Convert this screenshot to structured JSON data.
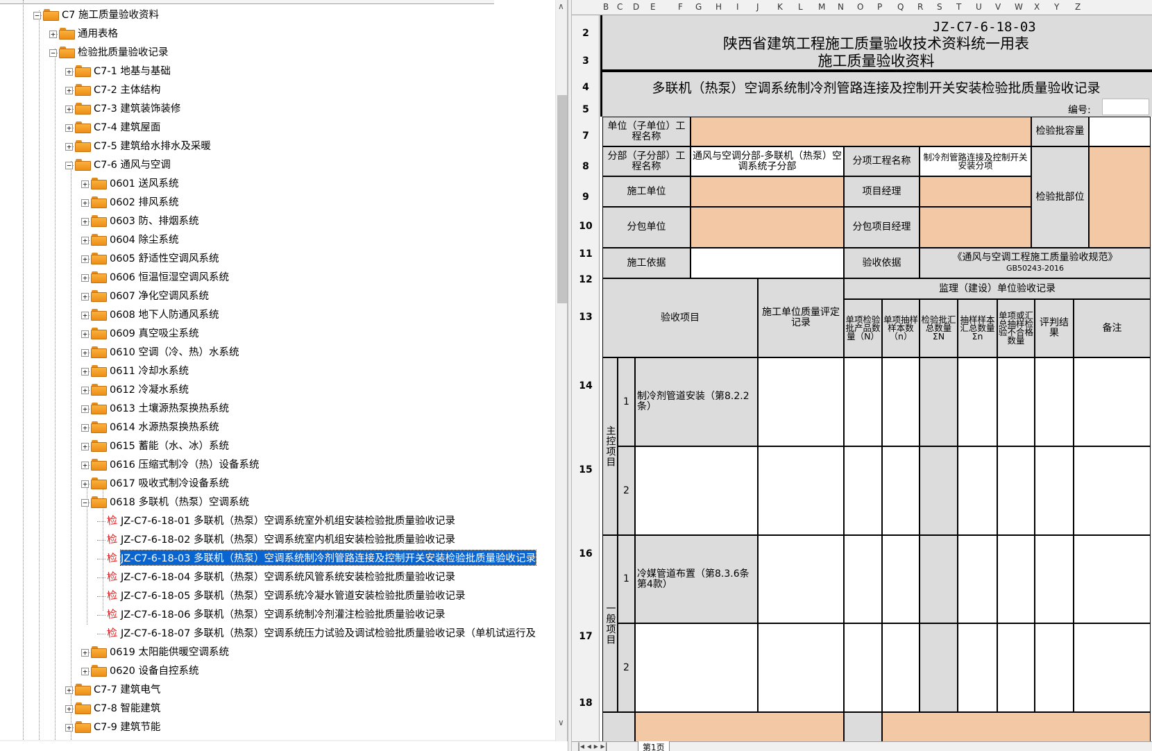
{
  "tree": {
    "items": [
      {
        "label": "C7 施工质量验收资料",
        "icon": "folder-open-icon",
        "expander": "−"
      },
      {
        "label": "通用表格",
        "icon": "folder-icon",
        "expander": "+"
      },
      {
        "label": "检验批质量验收记录",
        "icon": "folder-open-icon",
        "expander": "−"
      },
      {
        "label": "C7-1 地基与基础",
        "icon": "folder-icon",
        "expander": "+"
      },
      {
        "label": "C7-2 主体结构",
        "icon": "folder-icon",
        "expander": "+"
      },
      {
        "label": "C7-3 建筑装饰装修",
        "icon": "folder-icon",
        "expander": "+"
      },
      {
        "label": "C7-4 建筑屋面",
        "icon": "folder-icon",
        "expander": "+"
      },
      {
        "label": "C7-5 建筑给水排水及采暖",
        "icon": "folder-icon",
        "expander": "+"
      },
      {
        "label": "C7-6 通风与空调",
        "icon": "folder-open-icon",
        "expander": "−"
      },
      {
        "label": "0601 送风系统",
        "icon": "folder-icon",
        "expander": "+"
      },
      {
        "label": "0602 排风系统",
        "icon": "folder-icon",
        "expander": "+"
      },
      {
        "label": "0603 防、排烟系统",
        "icon": "folder-icon",
        "expander": "+"
      },
      {
        "label": "0604 除尘系统",
        "icon": "folder-icon",
        "expander": "+"
      },
      {
        "label": "0605 舒适性空调风系统",
        "icon": "folder-icon",
        "expander": "+"
      },
      {
        "label": "0606 恒温恒湿空调风系统",
        "icon": "folder-icon",
        "expander": "+"
      },
      {
        "label": "0607 净化空调风系统",
        "icon": "folder-icon",
        "expander": "+"
      },
      {
        "label": "0608 地下人防通风系统",
        "icon": "folder-icon",
        "expander": "+"
      },
      {
        "label": "0609 真空吸尘系统",
        "icon": "folder-icon",
        "expander": "+"
      },
      {
        "label": "0610 空调（冷、热）水系统",
        "icon": "folder-icon",
        "expander": "+"
      },
      {
        "label": "0611 冷却水系统",
        "icon": "folder-icon",
        "expander": "+"
      },
      {
        "label": "0612 冷凝水系统",
        "icon": "folder-icon",
        "expander": "+"
      },
      {
        "label": "0613 土壤源热泵换热系统",
        "icon": "folder-icon",
        "expander": "+"
      },
      {
        "label": "0614 水源热泵换热系统",
        "icon": "folder-icon",
        "expander": "+"
      },
      {
        "label": "0615 蓄能（水、冰）系统",
        "icon": "folder-icon",
        "expander": "+"
      },
      {
        "label": "0616 压缩式制冷（热）设备系统",
        "icon": "folder-icon",
        "expander": "+"
      },
      {
        "label": "0617 吸收式制冷设备系统",
        "icon": "folder-icon",
        "expander": "+"
      },
      {
        "label": "0618 多联机（热泵）空调系统",
        "icon": "folder-open-icon",
        "expander": "−"
      },
      {
        "label": "JZ-C7-6-18-01 多联机（热泵）空调系统室外机组安装检验批质量验收记录",
        "icon": "jian-doc-icon"
      },
      {
        "label": "JZ-C7-6-18-02 多联机（热泵）空调系统室内机组安装检验批质量验收记录",
        "icon": "jian-doc-icon"
      },
      {
        "label": "JZ-C7-6-18-03 多联机（热泵）空调系统制冷剂管路连接及控制开关安装检验批质量验收记录",
        "icon": "jian-doc-icon",
        "selected": true
      },
      {
        "label": "JZ-C7-6-18-04 多联机（热泵）空调系统风管系统安装检验批质量验收记录",
        "icon": "jian-doc-icon"
      },
      {
        "label": "JZ-C7-6-18-05 多联机（热泵）空调系统冷凝水管道安装检验批质量验收记录",
        "icon": "jian-doc-icon"
      },
      {
        "label": "JZ-C7-6-18-06 多联机（热泵）空调系统制冷剂灌注检验批质量验收记录",
        "icon": "jian-doc-icon"
      },
      {
        "label": "JZ-C7-6-18-07 多联机（热泵）空调系统压力试验及调试检验批质量验收记录（单机试运行及",
        "icon": "jian-doc-icon"
      },
      {
        "label": "0619 太阳能供暖空调系统",
        "icon": "folder-icon",
        "expander": "+"
      },
      {
        "label": "0620 设备自控系统",
        "icon": "folder-icon",
        "expander": "+"
      },
      {
        "label": "C7-7 建筑电气",
        "icon": "folder-icon",
        "expander": "+"
      },
      {
        "label": "C7-8 智能建筑",
        "icon": "folder-icon",
        "expander": "+"
      },
      {
        "label": "C7-9 建筑节能",
        "icon": "folder-icon",
        "expander": "+"
      }
    ],
    "jian_glyph": "检"
  },
  "sheet": {
    "columns": [
      "B",
      "C",
      "D",
      "E",
      "F",
      "G",
      "H",
      "I",
      "J",
      "K",
      "L",
      "M",
      "N",
      "O",
      "P",
      "Q",
      "R",
      "S",
      "T",
      "U",
      "V",
      "W",
      "X",
      "Y",
      "Z"
    ],
    "rows": [
      "2",
      "3",
      "4",
      "5",
      "7",
      "8",
      "9",
      "10",
      "11",
      "12",
      "13",
      "14",
      "15",
      "16",
      "17",
      "18"
    ],
    "code": "JZ-C7-6-18-03",
    "title1": "陕西省建筑工程施工质量验收技术资料统一用表",
    "title2": "施工质量验收资料",
    "subtitle": "多联机（热泵）空调系统制冷剂管路连接及控制开关安装检验批质量验收记录",
    "number_label": "编号:",
    "unit_name_label": "单位（子单位）工程名称",
    "batch_capacity_label": "检验批容量",
    "division_label": "分部（子分部）工程名称",
    "division_value": "通风与空调分部-多联机（热泵）空调系统子分部",
    "sub_item_label": "分项工程名称",
    "sub_item_value": "制冷剂管路连接及控制开关安装分项",
    "construction_unit_label": "施工单位",
    "pm_label": "项目经理",
    "batch_location_label": "检验批部位",
    "subcontractor_label": "分包单位",
    "sub_pm_label": "分包项目经理",
    "basis_label": "施工依据",
    "acceptance_basis_label": "验收依据",
    "standard_name": "《通风与空调工程施工质量验收规范》",
    "standard_code": "GB50243-2016",
    "supervision_header": "监理（建设）单位验收记录",
    "acceptance_item_header": "验收项目",
    "quality_record_header": "施工单位质量评定记录",
    "h_n_total": "单项检验批产品数量（N）",
    "h_n_sample": "单项抽样样本数（n）",
    "h_sum_N": "检验批汇总数量ΣN",
    "h_sum_n": "抽样样本汇总数量Σn",
    "h_unqualified": "单项或汇总抽样检验不合格数量",
    "h_result": "评判结果",
    "h_remark": "备注",
    "main_control": "主控项目",
    "general": "一般项目",
    "item_1": "1",
    "item_2": "2",
    "main_item_1": "制冷剂管道安装（第8.2.2条）",
    "general_item_1": "冷媒管道布置（第8.3.6条第4款）"
  },
  "tabs": {
    "sheet1": "第1页"
  }
}
